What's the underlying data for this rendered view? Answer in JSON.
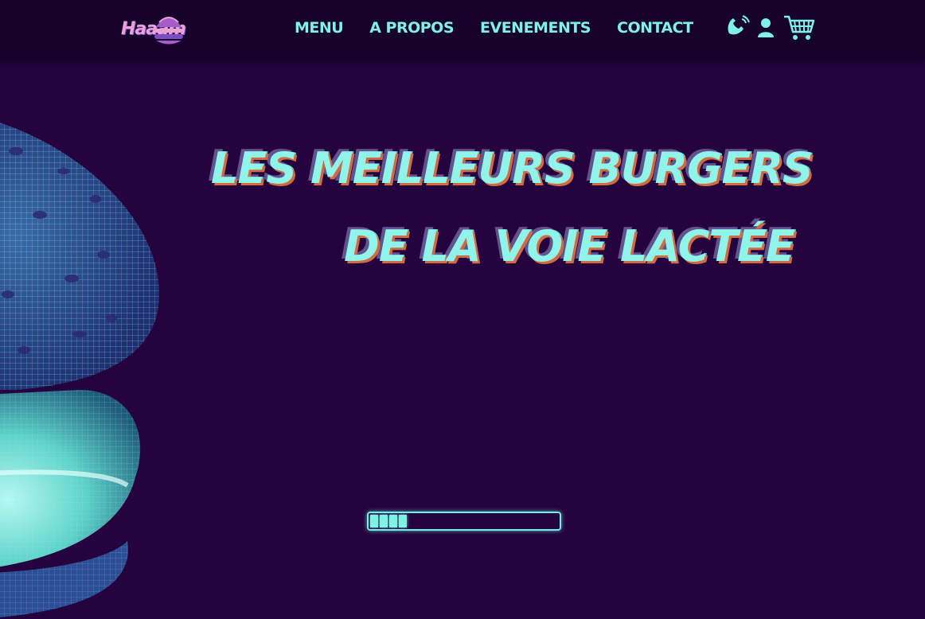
{
  "header": {
    "logo_text": "Haaam",
    "nav": [
      {
        "label": "MENU"
      },
      {
        "label": "A PROPOS"
      },
      {
        "label": "EVENEMENTS"
      },
      {
        "label": "CONTACT"
      }
    ],
    "icons": [
      "phone-icon",
      "user-icon",
      "cart-icon"
    ]
  },
  "hero": {
    "line1": "LES MEILLEURS BURGERS",
    "line2": "DE LA VOIE LACTÉE"
  },
  "loader": {
    "progress": 0.2
  },
  "colors": {
    "background": "#24033e",
    "navbar": "#17022b",
    "accent": "#7ff2e6",
    "shadow_orange": "#d26a3e",
    "logo_pink": "#e9a1d6"
  }
}
